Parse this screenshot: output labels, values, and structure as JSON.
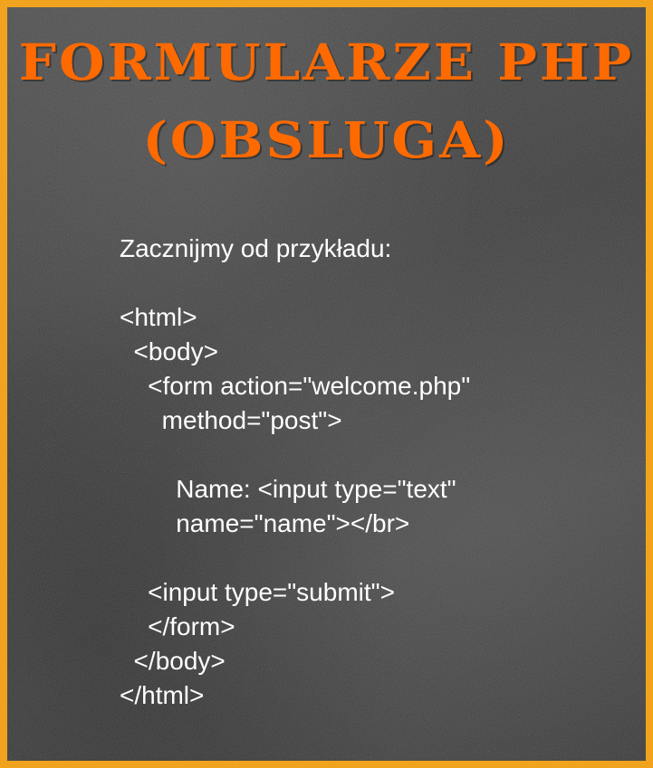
{
  "slide": {
    "title_line1": "FORMULARZE PHP",
    "title_line2": "(OBSLUGA)",
    "colors": {
      "title": "#ff6a00",
      "frame": "#f2a31e",
      "board": "#404040",
      "text": "#ffffff"
    },
    "intro": "Zacznijmy od przykładu:",
    "code_lines": [
      "<html>",
      "  <body>",
      "    <form action=\"welcome.php\"",
      "      method=\"post\">",
      "",
      "        Name: <input type=\"text\"",
      "        name=\"name\"></br>",
      "",
      "    <input type=\"submit\">",
      "    </form>",
      "  </body>",
      "</html>"
    ]
  }
}
